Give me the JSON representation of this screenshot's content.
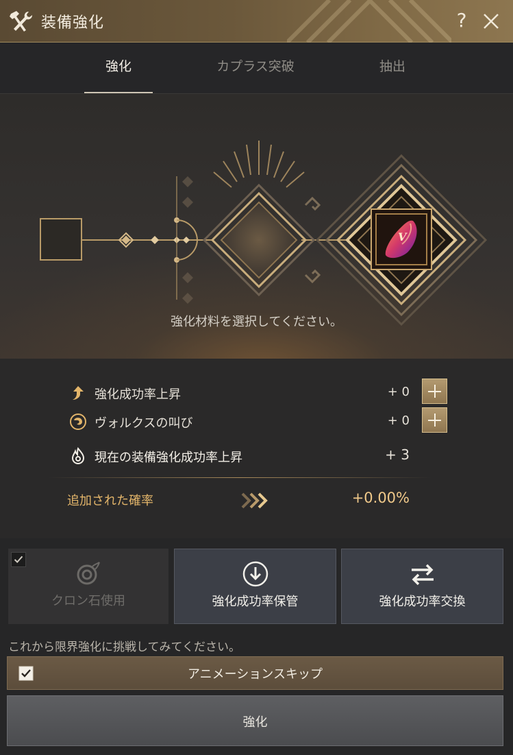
{
  "window": {
    "title": "装備強化",
    "help_label": "?",
    "icons": {
      "title": "hammer-wrench-icon",
      "close": "close-icon"
    }
  },
  "tabs": [
    {
      "label": "強化",
      "active": true
    },
    {
      "label": "カプラス突破",
      "active": false
    },
    {
      "label": "抽出",
      "active": false
    }
  ],
  "stage": {
    "message": "強化材料を選択してください。",
    "item_badge": "V"
  },
  "stats": {
    "rows": [
      {
        "label": "強化成功率上昇",
        "value": "+ 0",
        "icon": "arrow-up-icon",
        "has_plus": true
      },
      {
        "label": "ヴォルクスの叫び",
        "value": "+ 0",
        "icon": "voltex-cry-icon",
        "has_plus": true
      },
      {
        "label": "現在の装備強化成功率上昇",
        "value": "+ 3",
        "icon": "flame-icon",
        "has_plus": false
      }
    ],
    "added_label": "追加された確率",
    "added_value": "+0.00%"
  },
  "buttons": {
    "cron_stone": "クロン石使用",
    "store_rate": "強化成功率保管",
    "exchange_rate": "強化成功率交換"
  },
  "hint": "これから限界強化に挑戦してみてください。",
  "animation_skip": {
    "label": "アニメーションスキップ",
    "checked": true
  },
  "enhance_button": "強化",
  "colors": {
    "accent_gold": "#e3b56a",
    "title_bar": "#6b583b",
    "panel": "#2a2929"
  }
}
